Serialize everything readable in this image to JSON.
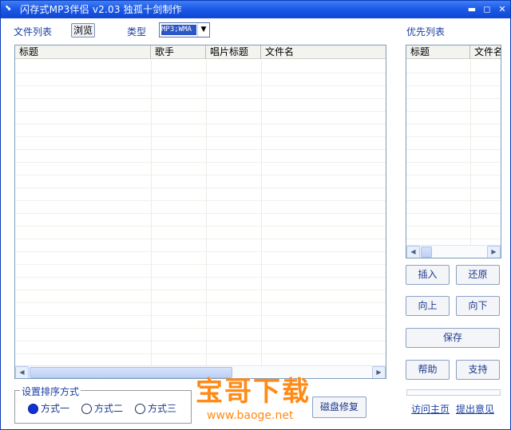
{
  "window": {
    "title": "闪存式MP3伴侣 v2.03 独孤十剑制作",
    "controls": {
      "minimize": "▬",
      "maximize": "◻",
      "close": "✕"
    }
  },
  "file_list": {
    "label": "文件列表",
    "browse_button": "浏览",
    "type_label": "类型",
    "type_value": "MP3;WMA",
    "columns": [
      "标题",
      "歌手",
      "唱片标题",
      "文件名"
    ],
    "rows": []
  },
  "priority_list": {
    "label": "优先列表",
    "columns": [
      "标题",
      "文件名"
    ],
    "rows": []
  },
  "buttons": {
    "insert": "插入",
    "restore": "还原",
    "move_up": "向上",
    "move_down": "向下",
    "save": "保存",
    "help": "帮助",
    "support": "支持",
    "disk_repair": "磁盘修复"
  },
  "sort": {
    "group_title": "设置排序方式",
    "options": [
      "方式一",
      "方式二",
      "方式三"
    ],
    "selected": "方式一"
  },
  "links": {
    "homepage": "访问主页",
    "feedback": "提出意见"
  },
  "watermark": {
    "main": "宝哥下载",
    "sub": "www.baoge.net"
  },
  "colors": {
    "titlebar": "#1d5ae6",
    "label_text": "#1c3fa3",
    "watermark": "#ff8a16",
    "radio_checked": "#1030d8"
  }
}
